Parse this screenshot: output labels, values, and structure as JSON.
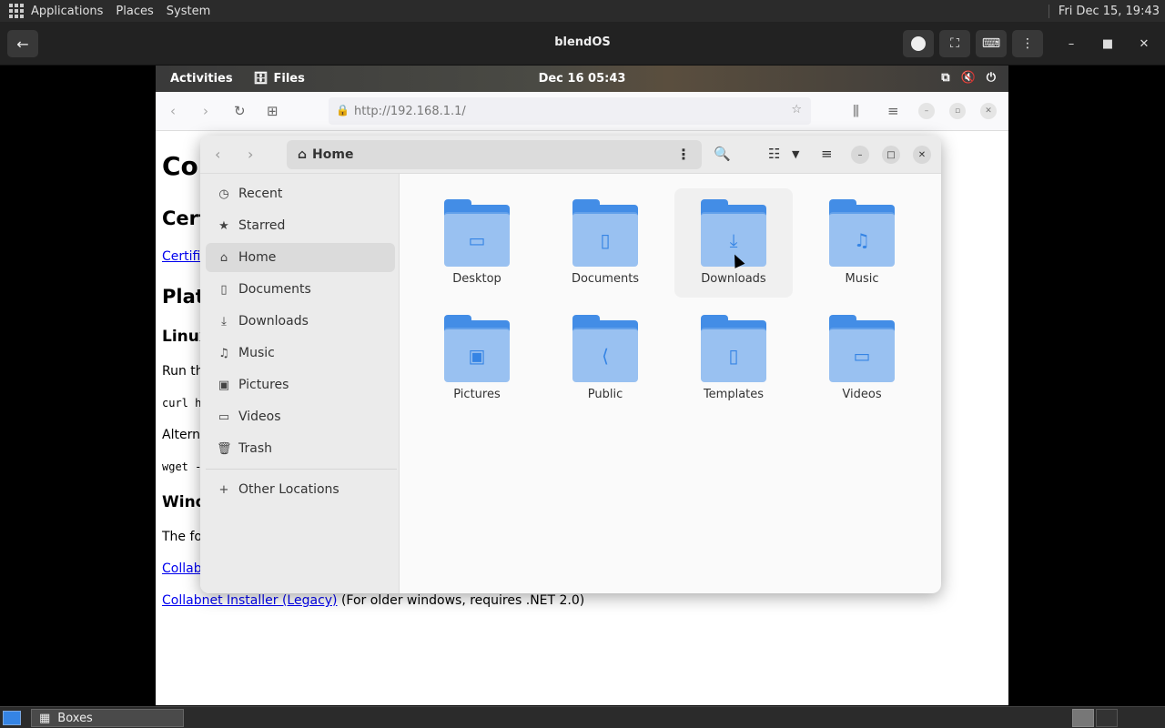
{
  "host": {
    "menus": [
      "Applications",
      "Places",
      "System"
    ],
    "clock": "Fri Dec 15, 19:43"
  },
  "boxes": {
    "title": "blendOS"
  },
  "guest": {
    "activities": "Activities",
    "app_name": "Files",
    "clock": "Dec 16  05:43"
  },
  "browser": {
    "url": "http://192.168.1.1/"
  },
  "webpage": {
    "h1": "Col",
    "h2_cert": "Cert",
    "link_cert": "Certifi",
    "h2_plat": "Plat",
    "h3_linux": "Linux",
    "p_run": "Run th",
    "code_curl": "curl h",
    "p_alt": "Altern",
    "code_wget": "wget -",
    "h3_wind": "Wind",
    "p_the": "The fo",
    "link_collab": "Collab",
    "link_legacy": "Collabnet Installer (Legacy)",
    "legacy_note": " (For older windows, requires .NET 2.0)"
  },
  "files": {
    "path_label": "Home",
    "sidebar": [
      {
        "label": "Recent",
        "icon": "clock-icon"
      },
      {
        "label": "Starred",
        "icon": "star-icon"
      },
      {
        "label": "Home",
        "icon": "home-icon"
      },
      {
        "label": "Documents",
        "icon": "document-icon"
      },
      {
        "label": "Downloads",
        "icon": "download-icon"
      },
      {
        "label": "Music",
        "icon": "music-icon"
      },
      {
        "label": "Pictures",
        "icon": "picture-icon"
      },
      {
        "label": "Videos",
        "icon": "video-icon"
      },
      {
        "label": "Trash",
        "icon": "trash-icon"
      }
    ],
    "other_locations": "Other Locations",
    "folders": [
      {
        "label": "Desktop",
        "icon": "desktop-folder-icon"
      },
      {
        "label": "Documents",
        "icon": "documents-folder-icon"
      },
      {
        "label": "Downloads",
        "icon": "downloads-folder-icon"
      },
      {
        "label": "Music",
        "icon": "music-folder-icon"
      },
      {
        "label": "Pictures",
        "icon": "pictures-folder-icon"
      },
      {
        "label": "Public",
        "icon": "public-folder-icon"
      },
      {
        "label": "Templates",
        "icon": "templates-folder-icon"
      },
      {
        "label": "Videos",
        "icon": "videos-folder-icon"
      }
    ]
  },
  "taskbar": {
    "task_label": "Boxes"
  }
}
